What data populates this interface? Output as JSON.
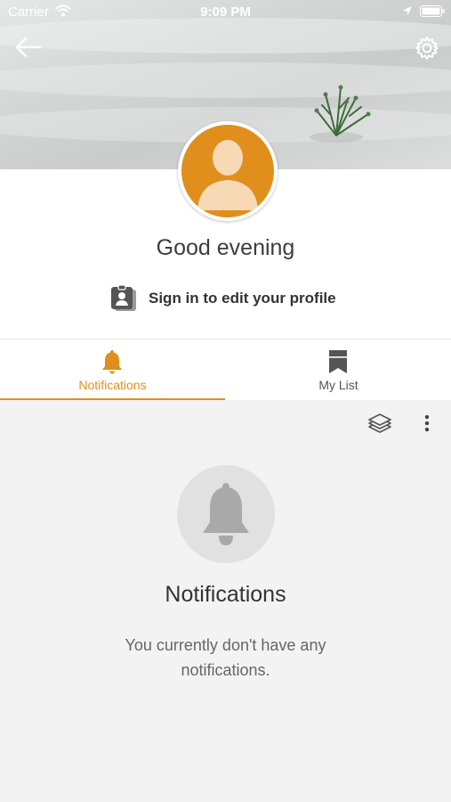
{
  "status_bar": {
    "carrier": "Carrier",
    "time": "9:09 PM"
  },
  "profile": {
    "greeting": "Good evening",
    "signin_label": "Sign in to edit your profile"
  },
  "tabs": [
    {
      "label": "Notifications",
      "icon": "bell-icon",
      "active": true
    },
    {
      "label": "My List",
      "icon": "bookmark-icon",
      "active": false
    }
  ],
  "empty_state": {
    "title": "Notifications",
    "message": "You currently don't have any notifications."
  },
  "colors": {
    "accent": "#e08f1d",
    "avatar_bg": "#e08f1d",
    "avatar_silhouette": "#f7d9b6",
    "empty_icon": "#a9a9a9"
  }
}
